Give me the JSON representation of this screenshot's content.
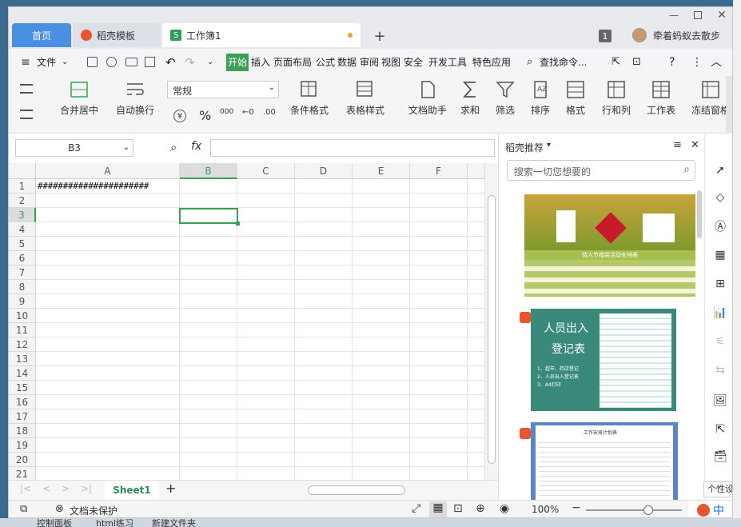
{
  "tabs": [
    {
      "label": "首页"
    },
    {
      "label": "稻壳模板"
    },
    {
      "label": "工作簿1"
    }
  ],
  "titlebar": {
    "badge": "1",
    "user": "牵着蚂蚁去散步"
  },
  "menu": {
    "file": "文件",
    "items": [
      "开始",
      "插入",
      "页面布局",
      "公式",
      "数据",
      "审阅",
      "视图",
      "安全",
      "开发工具",
      "特色应用"
    ],
    "search": "查找命令..."
  },
  "ribbon": {
    "merge": "合并居中",
    "wrap": "自动换行",
    "format_value": "常规",
    "cond_format": "条件格式",
    "table_style": "表格样式",
    "doc_helper": "文档助手",
    "sum": "求和",
    "filter": "筛选",
    "sort": "排序",
    "format": "格式",
    "rowcol": "行和列",
    "worksheet": "工作表",
    "freeze": "冻结窗格",
    "pct": "%",
    "thousand": "000"
  },
  "formula": {
    "cell_ref": "B3",
    "fx": "fx",
    "value": ""
  },
  "grid": {
    "columns": [
      "A",
      "B",
      "C",
      "D",
      "E",
      "F"
    ],
    "rows": [
      "1",
      "2",
      "3",
      "4",
      "5",
      "6",
      "7",
      "8",
      "9",
      "10",
      "11",
      "12",
      "13",
      "14",
      "15",
      "16",
      "17",
      "18",
      "19",
      "20",
      "21"
    ],
    "a1": "######################",
    "selected_col": "B",
    "selected_row": "3"
  },
  "panel": {
    "title": "稻壳推荐",
    "search_placeholder": "搜索一切您想要的",
    "t1_title": "情人节福袋活动安排表",
    "t2_title1": "人员出入",
    "t2_title2": "登记表",
    "t2_items": [
      "1、超市、药店登记",
      "2、人员出入登记表",
      "3、A4打印"
    ],
    "t3_title": "工作安排计划表"
  },
  "sheetbar": {
    "sheet": "Sheet1"
  },
  "status": {
    "protect": "文档未保护",
    "zoom": "100%"
  },
  "desktop": {
    "taskbar": [
      "控制面板",
      "html练习",
      "新建文件夹"
    ],
    "ime": "中",
    "tooltip": "个性设置,"
  },
  "colors": {
    "accent": "#2e8b57",
    "tab_home": "#4a90e2",
    "menu_active": "#3c9f56"
  }
}
